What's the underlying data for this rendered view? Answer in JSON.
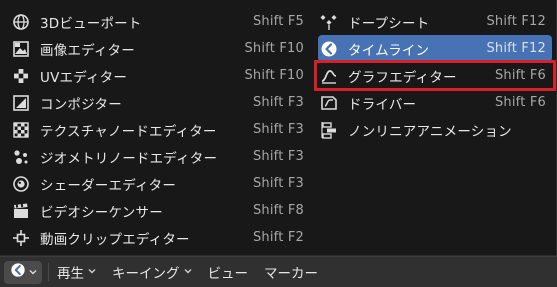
{
  "left_column": [
    {
      "label": "3Dビューポート",
      "shortcut": "Shift F5",
      "icon": "3d-viewport-icon"
    },
    {
      "label": "画像エディター",
      "shortcut": "Shift F10",
      "icon": "image-editor-icon"
    },
    {
      "label": "UVエディター",
      "shortcut": "Shift F10",
      "icon": "uv-editor-icon"
    },
    {
      "label": "コンポジター",
      "shortcut": "Shift F3",
      "icon": "compositor-icon"
    },
    {
      "label": "テクスチャノードエディター",
      "shortcut": "Shift F3",
      "icon": "texture-node-editor-icon"
    },
    {
      "label": "ジオメトリノードエディター",
      "shortcut": "Shift F3",
      "icon": "geometry-node-editor-icon"
    },
    {
      "label": "シェーダーエディター",
      "shortcut": "Shift F3",
      "icon": "shader-editor-icon"
    },
    {
      "label": "ビデオシーケンサー",
      "shortcut": "Shift F8",
      "icon": "video-sequencer-icon"
    },
    {
      "label": "動画クリップエディター",
      "shortcut": "Shift F2",
      "icon": "movie-clip-editor-icon"
    }
  ],
  "right_column": [
    {
      "label": "ドープシート",
      "shortcut": "Shift F12",
      "icon": "dope-sheet-icon"
    },
    {
      "label": "タイムライン",
      "shortcut": "Shift F12",
      "icon": "timeline-icon",
      "active": true
    },
    {
      "label": "グラフエディター",
      "shortcut": "Shift F6",
      "icon": "graph-editor-icon",
      "highlighted": true
    },
    {
      "label": "ドライバー",
      "shortcut": "Shift F6",
      "icon": "drivers-icon"
    },
    {
      "label": "ノンリニアアニメーション",
      "shortcut": "",
      "icon": "nla-icon"
    }
  ],
  "header": {
    "editor_type_icon": "timeline-icon",
    "menus": [
      "再生",
      "キーイング",
      "ビュー",
      "マーカー"
    ]
  },
  "colors": {
    "active": "#4772b3",
    "highlight_box": "#d6212b",
    "menu_bg": "#181818",
    "header_bg": "#303030"
  }
}
